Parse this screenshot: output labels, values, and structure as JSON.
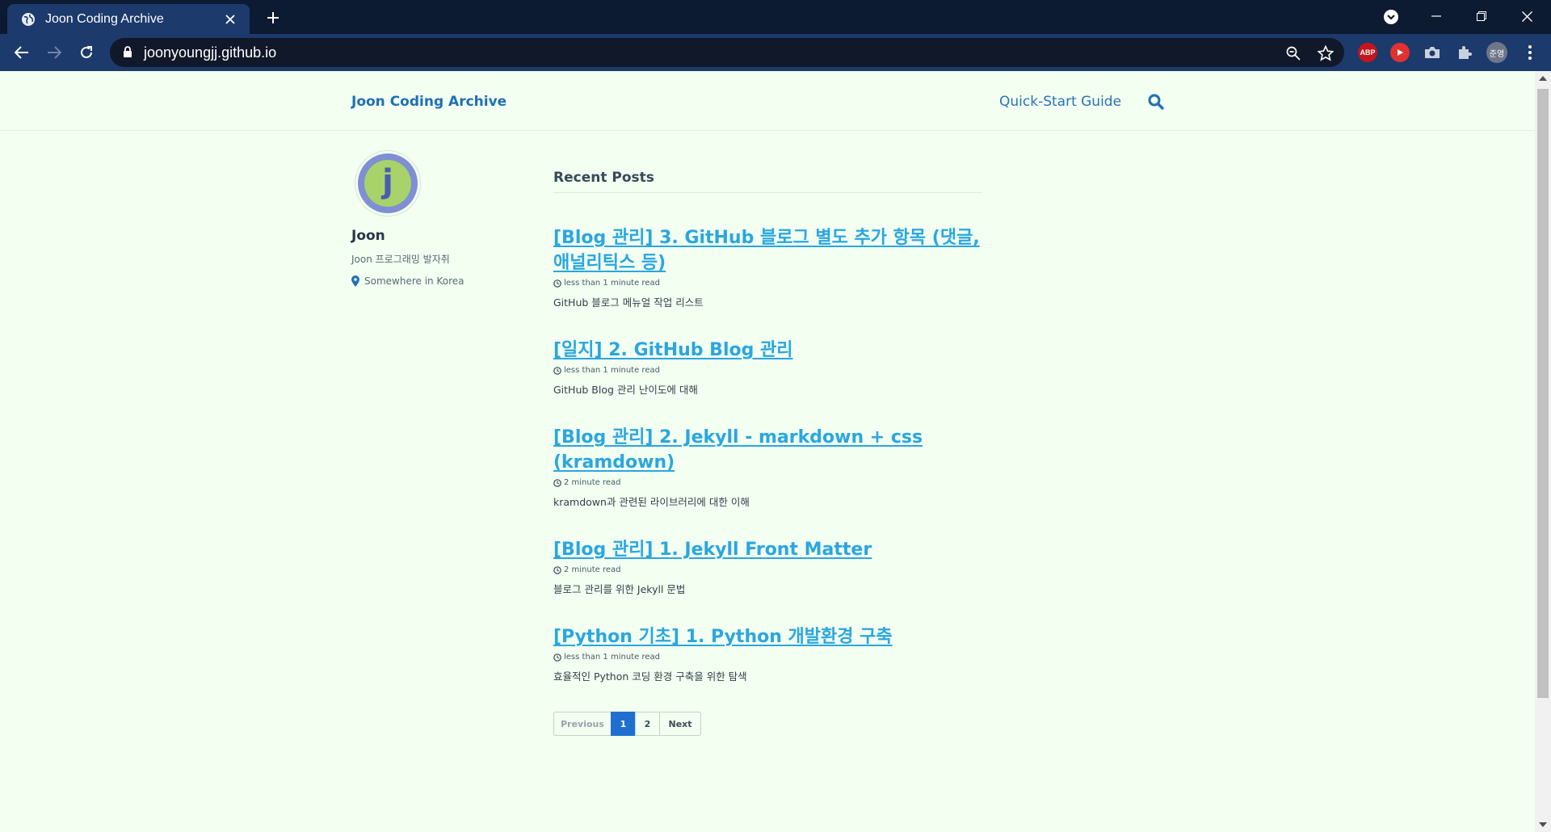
{
  "browser": {
    "tab_title": "Joon Coding Archive",
    "url": "joonyoungjj.github.io",
    "extensions": {
      "abp_label": "ABP",
      "profile_label": "준영"
    }
  },
  "site": {
    "title": "Joon Coding Archive",
    "nav_link": "Quick-Start Guide"
  },
  "author": {
    "name": "Joon",
    "bio": "Joon 프로그래밍 발자취",
    "location": "Somewhere in Korea",
    "avatar_letter": "j"
  },
  "main": {
    "section_title": "Recent Posts",
    "posts": [
      {
        "title": "[Blog 관리] 3. GitHub 블로그 별도 추가 항목 (댓글, 애널리틱스 등)",
        "read_time": "less than 1 minute read",
        "excerpt": "GitHub 블로그 메뉴얼 작업 리스트"
      },
      {
        "title": "[일지] 2. GitHub Blog 관리",
        "read_time": "less than 1 minute read",
        "excerpt": "GitHub Blog 관리 난이도에 대해"
      },
      {
        "title": "[Blog 관리] 2. Jekyll - markdown + css (kramdown)",
        "read_time": "2 minute read",
        "excerpt": "kramdown과 관련된 라이브러리에 대한 이해"
      },
      {
        "title": "[Blog 관리] 1. Jekyll Front Matter",
        "read_time": "2 minute read",
        "excerpt": "블로그 관리를 위한 Jekyll 문법"
      },
      {
        "title": "[Python 기초] 1. Python 개발환경 구축",
        "read_time": "less than 1 minute read",
        "excerpt": "효율적인 Python 코딩 환경 구축을 위한 탐색"
      }
    ],
    "pagination": {
      "previous": "Previous",
      "pages": [
        "1",
        "2"
      ],
      "next": "Next"
    }
  },
  "colors": {
    "page_bg": "#f2fff1",
    "link": "#2aa6e0",
    "title": "#1f6fb5",
    "active_page": "#1f6fd0",
    "chrome_tabstrip": "#0c1a32",
    "chrome_toolbar": "#1c3a6b"
  }
}
